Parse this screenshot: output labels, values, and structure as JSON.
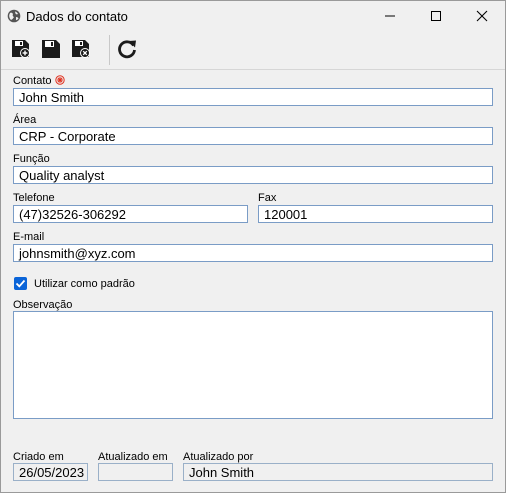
{
  "window": {
    "title": "Dados do contato",
    "icons": {
      "app": "globe-icon",
      "minimize": "minimize-icon",
      "maximize": "maximize-icon",
      "close": "close-icon"
    }
  },
  "toolbar": {
    "buttons": [
      {
        "name": "save-new",
        "icon": "save-new-icon"
      },
      {
        "name": "save",
        "icon": "save-icon"
      },
      {
        "name": "save-close",
        "icon": "save-close-icon"
      },
      {
        "name": "refresh",
        "icon": "refresh-icon"
      }
    ]
  },
  "form": {
    "contato": {
      "label": "Contato",
      "value": "John Smith",
      "required_icon": "required-icon"
    },
    "area": {
      "label": "Área",
      "value": "CRP - Corporate"
    },
    "funcao": {
      "label": "Função",
      "value": "Quality analyst"
    },
    "telefone": {
      "label": "Telefone",
      "value": "(47)32526-306292"
    },
    "fax": {
      "label": "Fax",
      "value": "120001"
    },
    "email": {
      "label": "E-mail",
      "value": "johnsmith@xyz.com"
    },
    "default": {
      "label": "Utilizar como padrão",
      "checked": true
    },
    "observacao": {
      "label": "Observação",
      "value": ""
    },
    "criado_em": {
      "label": "Criado em",
      "value": "26/05/2023"
    },
    "atualizado_em": {
      "label": "Atualizado em",
      "value": ""
    },
    "atualizado_por": {
      "label": "Atualizado por",
      "value": "John Smith"
    }
  },
  "colors": {
    "accent": "#0a64d8",
    "field_border": "#7a9cc6",
    "required": "#e0301e",
    "background": "#f0f0f0"
  }
}
